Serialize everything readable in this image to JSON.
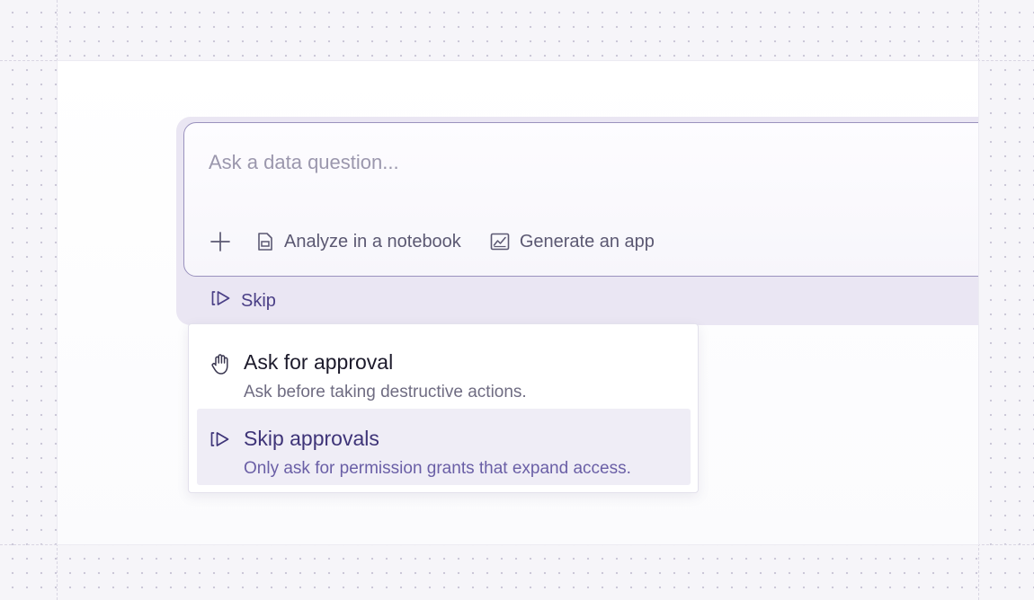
{
  "composer": {
    "placeholder": "Ask a data question...",
    "toolbar": {
      "add_icon": "plus-icon",
      "notebook": {
        "icon": "notebook-icon",
        "label": "Analyze in a notebook"
      },
      "app": {
        "icon": "chart-app-icon",
        "label": "Generate an app"
      }
    }
  },
  "approval_mode": {
    "icon": "skip-approvals-icon",
    "label": "Skip"
  },
  "menu": {
    "items": [
      {
        "icon": "hand-icon",
        "title": "Ask for approval",
        "description": "Ask before taking destructive actions.",
        "selected": false
      },
      {
        "icon": "skip-approvals-icon",
        "title": "Skip approvals",
        "description": "Only ask for permission grants that expand access.",
        "selected": true
      }
    ]
  },
  "colors": {
    "accent": "#4a3f86",
    "selected_bg": "#efedf6",
    "composer_border": "#9a92be",
    "composer_tray": "#eae6f3"
  }
}
